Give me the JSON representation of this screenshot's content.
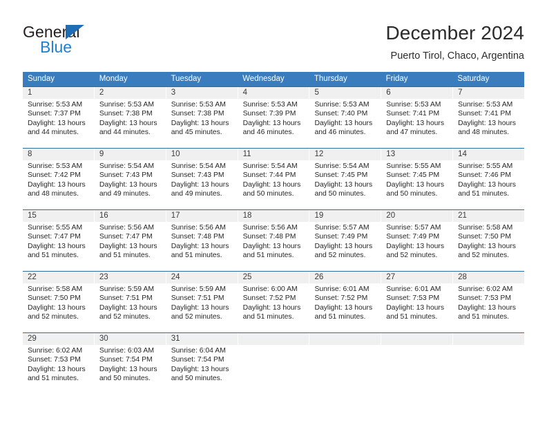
{
  "brand": {
    "name_part1": "General",
    "name_part2": "Blue",
    "triangle_color": "#1f6db5",
    "blue_color": "#1f7fd0"
  },
  "header": {
    "title": "December 2024",
    "location": "Puerto Tirol, Chaco, Argentina"
  },
  "theme": {
    "header_blue": "#3a7dbf",
    "row_rule_blue": "#2e6da4",
    "daynum_band": "#f0f0f0"
  },
  "weekdays": [
    "Sunday",
    "Monday",
    "Tuesday",
    "Wednesday",
    "Thursday",
    "Friday",
    "Saturday"
  ],
  "weeks": [
    {
      "days": [
        {
          "num": "1",
          "sunrise": "Sunrise: 5:53 AM",
          "sunset": "Sunset: 7:37 PM",
          "daylight1": "Daylight: 13 hours",
          "daylight2": "and 44 minutes."
        },
        {
          "num": "2",
          "sunrise": "Sunrise: 5:53 AM",
          "sunset": "Sunset: 7:38 PM",
          "daylight1": "Daylight: 13 hours",
          "daylight2": "and 44 minutes."
        },
        {
          "num": "3",
          "sunrise": "Sunrise: 5:53 AM",
          "sunset": "Sunset: 7:38 PM",
          "daylight1": "Daylight: 13 hours",
          "daylight2": "and 45 minutes."
        },
        {
          "num": "4",
          "sunrise": "Sunrise: 5:53 AM",
          "sunset": "Sunset: 7:39 PM",
          "daylight1": "Daylight: 13 hours",
          "daylight2": "and 46 minutes."
        },
        {
          "num": "5",
          "sunrise": "Sunrise: 5:53 AM",
          "sunset": "Sunset: 7:40 PM",
          "daylight1": "Daylight: 13 hours",
          "daylight2": "and 46 minutes."
        },
        {
          "num": "6",
          "sunrise": "Sunrise: 5:53 AM",
          "sunset": "Sunset: 7:41 PM",
          "daylight1": "Daylight: 13 hours",
          "daylight2": "and 47 minutes."
        },
        {
          "num": "7",
          "sunrise": "Sunrise: 5:53 AM",
          "sunset": "Sunset: 7:41 PM",
          "daylight1": "Daylight: 13 hours",
          "daylight2": "and 48 minutes."
        }
      ]
    },
    {
      "days": [
        {
          "num": "8",
          "sunrise": "Sunrise: 5:53 AM",
          "sunset": "Sunset: 7:42 PM",
          "daylight1": "Daylight: 13 hours",
          "daylight2": "and 48 minutes."
        },
        {
          "num": "9",
          "sunrise": "Sunrise: 5:54 AM",
          "sunset": "Sunset: 7:43 PM",
          "daylight1": "Daylight: 13 hours",
          "daylight2": "and 49 minutes."
        },
        {
          "num": "10",
          "sunrise": "Sunrise: 5:54 AM",
          "sunset": "Sunset: 7:43 PM",
          "daylight1": "Daylight: 13 hours",
          "daylight2": "and 49 minutes."
        },
        {
          "num": "11",
          "sunrise": "Sunrise: 5:54 AM",
          "sunset": "Sunset: 7:44 PM",
          "daylight1": "Daylight: 13 hours",
          "daylight2": "and 50 minutes."
        },
        {
          "num": "12",
          "sunrise": "Sunrise: 5:54 AM",
          "sunset": "Sunset: 7:45 PM",
          "daylight1": "Daylight: 13 hours",
          "daylight2": "and 50 minutes."
        },
        {
          "num": "13",
          "sunrise": "Sunrise: 5:55 AM",
          "sunset": "Sunset: 7:45 PM",
          "daylight1": "Daylight: 13 hours",
          "daylight2": "and 50 minutes."
        },
        {
          "num": "14",
          "sunrise": "Sunrise: 5:55 AM",
          "sunset": "Sunset: 7:46 PM",
          "daylight1": "Daylight: 13 hours",
          "daylight2": "and 51 minutes."
        }
      ]
    },
    {
      "days": [
        {
          "num": "15",
          "sunrise": "Sunrise: 5:55 AM",
          "sunset": "Sunset: 7:47 PM",
          "daylight1": "Daylight: 13 hours",
          "daylight2": "and 51 minutes."
        },
        {
          "num": "16",
          "sunrise": "Sunrise: 5:56 AM",
          "sunset": "Sunset: 7:47 PM",
          "daylight1": "Daylight: 13 hours",
          "daylight2": "and 51 minutes."
        },
        {
          "num": "17",
          "sunrise": "Sunrise: 5:56 AM",
          "sunset": "Sunset: 7:48 PM",
          "daylight1": "Daylight: 13 hours",
          "daylight2": "and 51 minutes."
        },
        {
          "num": "18",
          "sunrise": "Sunrise: 5:56 AM",
          "sunset": "Sunset: 7:48 PM",
          "daylight1": "Daylight: 13 hours",
          "daylight2": "and 51 minutes."
        },
        {
          "num": "19",
          "sunrise": "Sunrise: 5:57 AM",
          "sunset": "Sunset: 7:49 PM",
          "daylight1": "Daylight: 13 hours",
          "daylight2": "and 52 minutes."
        },
        {
          "num": "20",
          "sunrise": "Sunrise: 5:57 AM",
          "sunset": "Sunset: 7:49 PM",
          "daylight1": "Daylight: 13 hours",
          "daylight2": "and 52 minutes."
        },
        {
          "num": "21",
          "sunrise": "Sunrise: 5:58 AM",
          "sunset": "Sunset: 7:50 PM",
          "daylight1": "Daylight: 13 hours",
          "daylight2": "and 52 minutes."
        }
      ]
    },
    {
      "days": [
        {
          "num": "22",
          "sunrise": "Sunrise: 5:58 AM",
          "sunset": "Sunset: 7:50 PM",
          "daylight1": "Daylight: 13 hours",
          "daylight2": "and 52 minutes."
        },
        {
          "num": "23",
          "sunrise": "Sunrise: 5:59 AM",
          "sunset": "Sunset: 7:51 PM",
          "daylight1": "Daylight: 13 hours",
          "daylight2": "and 52 minutes."
        },
        {
          "num": "24",
          "sunrise": "Sunrise: 5:59 AM",
          "sunset": "Sunset: 7:51 PM",
          "daylight1": "Daylight: 13 hours",
          "daylight2": "and 52 minutes."
        },
        {
          "num": "25",
          "sunrise": "Sunrise: 6:00 AM",
          "sunset": "Sunset: 7:52 PM",
          "daylight1": "Daylight: 13 hours",
          "daylight2": "and 51 minutes."
        },
        {
          "num": "26",
          "sunrise": "Sunrise: 6:01 AM",
          "sunset": "Sunset: 7:52 PM",
          "daylight1": "Daylight: 13 hours",
          "daylight2": "and 51 minutes."
        },
        {
          "num": "27",
          "sunrise": "Sunrise: 6:01 AM",
          "sunset": "Sunset: 7:53 PM",
          "daylight1": "Daylight: 13 hours",
          "daylight2": "and 51 minutes."
        },
        {
          "num": "28",
          "sunrise": "Sunrise: 6:02 AM",
          "sunset": "Sunset: 7:53 PM",
          "daylight1": "Daylight: 13 hours",
          "daylight2": "and 51 minutes."
        }
      ]
    },
    {
      "days": [
        {
          "num": "29",
          "sunrise": "Sunrise: 6:02 AM",
          "sunset": "Sunset: 7:53 PM",
          "daylight1": "Daylight: 13 hours",
          "daylight2": "and 51 minutes."
        },
        {
          "num": "30",
          "sunrise": "Sunrise: 6:03 AM",
          "sunset": "Sunset: 7:54 PM",
          "daylight1": "Daylight: 13 hours",
          "daylight2": "and 50 minutes."
        },
        {
          "num": "31",
          "sunrise": "Sunrise: 6:04 AM",
          "sunset": "Sunset: 7:54 PM",
          "daylight1": "Daylight: 13 hours",
          "daylight2": "and 50 minutes."
        },
        {
          "num": "",
          "sunrise": "",
          "sunset": "",
          "daylight1": "",
          "daylight2": ""
        },
        {
          "num": "",
          "sunrise": "",
          "sunset": "",
          "daylight1": "",
          "daylight2": ""
        },
        {
          "num": "",
          "sunrise": "",
          "sunset": "",
          "daylight1": "",
          "daylight2": ""
        },
        {
          "num": "",
          "sunrise": "",
          "sunset": "",
          "daylight1": "",
          "daylight2": ""
        }
      ]
    }
  ]
}
